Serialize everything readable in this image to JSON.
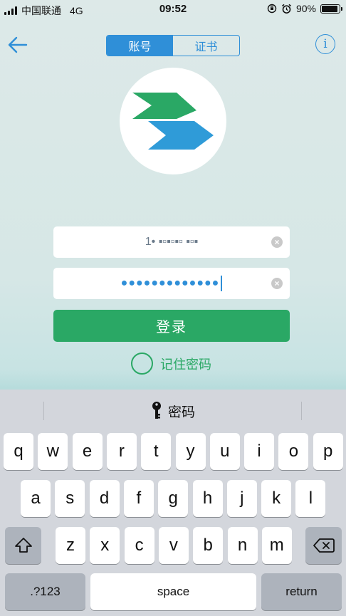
{
  "status_bar": {
    "carrier": "中国联通",
    "network": "4G",
    "time": "09:52",
    "battery": "90%",
    "battery_level": 0.9
  },
  "header": {
    "tabs": [
      "账号",
      "证书"
    ],
    "active_tab": 0,
    "info_symbol": "i"
  },
  "form": {
    "username_value": "1• ▪▫▪▫▪▫ ▪▫▪",
    "password_dots": "●●●●●●●●●●●●●",
    "clear_symbol": "×",
    "login_label": "登录",
    "remember_label": "记住密码"
  },
  "keyboard": {
    "suggestion": "密码",
    "row1": [
      "q",
      "w",
      "e",
      "r",
      "t",
      "y",
      "u",
      "i",
      "o",
      "p"
    ],
    "row2": [
      "a",
      "s",
      "d",
      "f",
      "g",
      "h",
      "j",
      "k",
      "l"
    ],
    "row3": [
      "z",
      "x",
      "c",
      "v",
      "b",
      "n",
      "m"
    ],
    "numbers_label": ".?123",
    "space_label": "space",
    "return_label": "return"
  },
  "colors": {
    "accent_blue": "#2f8fd8",
    "accent_green": "#2aa865"
  },
  "icons": [
    "back-arrow-icon",
    "info-icon",
    "app-logo",
    "clear-icon",
    "key-icon",
    "shift-icon",
    "backspace-icon"
  ]
}
